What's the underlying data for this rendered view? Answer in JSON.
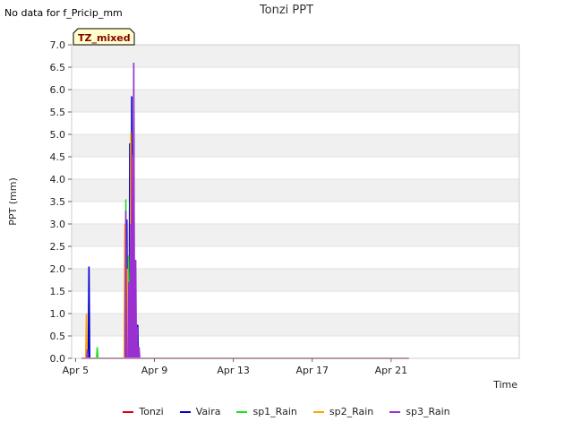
{
  "no_data_note": "No data for f_Pricip_mm",
  "colors": {
    "Tonzi": "#dd0000",
    "Vaira": "#0000cc",
    "sp1_Rain": "#22dd22",
    "sp2_Rain": "#ffa500",
    "sp3_Rain": "#9b30d0",
    "band": "#f0f0f0",
    "badge_fill": "#ffffcc"
  },
  "chart_data": {
    "type": "line",
    "title": "Tonzi PPT",
    "xlabel": "Time",
    "ylabel": "PPT (mm)",
    "badge": "TZ_mixed",
    "xlim": [
      0.8,
      23.5
    ],
    "ylim": [
      0,
      7.0
    ],
    "yticks": [
      "0.0",
      "0.5",
      "1.0",
      "1.5",
      "2.0",
      "2.5",
      "3.0",
      "3.5",
      "4.0",
      "4.5",
      "5.0",
      "5.5",
      "6.0",
      "6.5",
      "7.0"
    ],
    "xticks": [
      {
        "value": 1,
        "label": "Apr 5"
      },
      {
        "value": 5,
        "label": "Apr 9"
      },
      {
        "value": 9,
        "label": "Apr 13"
      },
      {
        "value": 13,
        "label": "Apr 17"
      },
      {
        "value": 17,
        "label": "Apr 21"
      }
    ],
    "grid_bands": true,
    "legend_position": "bottom",
    "series": [
      {
        "name": "Tonzi",
        "spikes": [
          [
            1.55,
            0.1
          ],
          [
            3.95,
            0.1
          ],
          [
            4.05,
            0.1
          ]
        ]
      },
      {
        "name": "Vaira",
        "spikes": [
          [
            1.68,
            2.05
          ],
          [
            3.6,
            3.1
          ],
          [
            3.75,
            4.8
          ],
          [
            3.85,
            5.85
          ],
          [
            3.95,
            5.5
          ],
          [
            4.15,
            0.75
          ],
          [
            4.2,
            0.25
          ]
        ]
      },
      {
        "name": "sp1_Rain",
        "spikes": [
          [
            2.1,
            0.25
          ],
          [
            3.55,
            3.55
          ],
          [
            3.68,
            2.3
          ],
          [
            3.78,
            1.8
          ]
        ]
      },
      {
        "name": "sp2_Rain",
        "spikes": [
          [
            1.55,
            1.0
          ],
          [
            3.5,
            3.0
          ],
          [
            3.62,
            2.0
          ],
          [
            3.8,
            5.05
          ],
          [
            3.92,
            4.5
          ],
          [
            4.0,
            0.5
          ]
        ]
      },
      {
        "name": "sp3_Rain",
        "spikes": [
          [
            1.6,
            0.2
          ],
          [
            3.55,
            3.3
          ],
          [
            3.7,
            1.7
          ],
          [
            3.8,
            3.0
          ],
          [
            3.85,
            4.55
          ],
          [
            3.95,
            6.6
          ],
          [
            4.05,
            2.2
          ],
          [
            4.12,
            0.7
          ],
          [
            4.22,
            0.25
          ]
        ]
      }
    ],
    "baseline_end": 17.9
  }
}
